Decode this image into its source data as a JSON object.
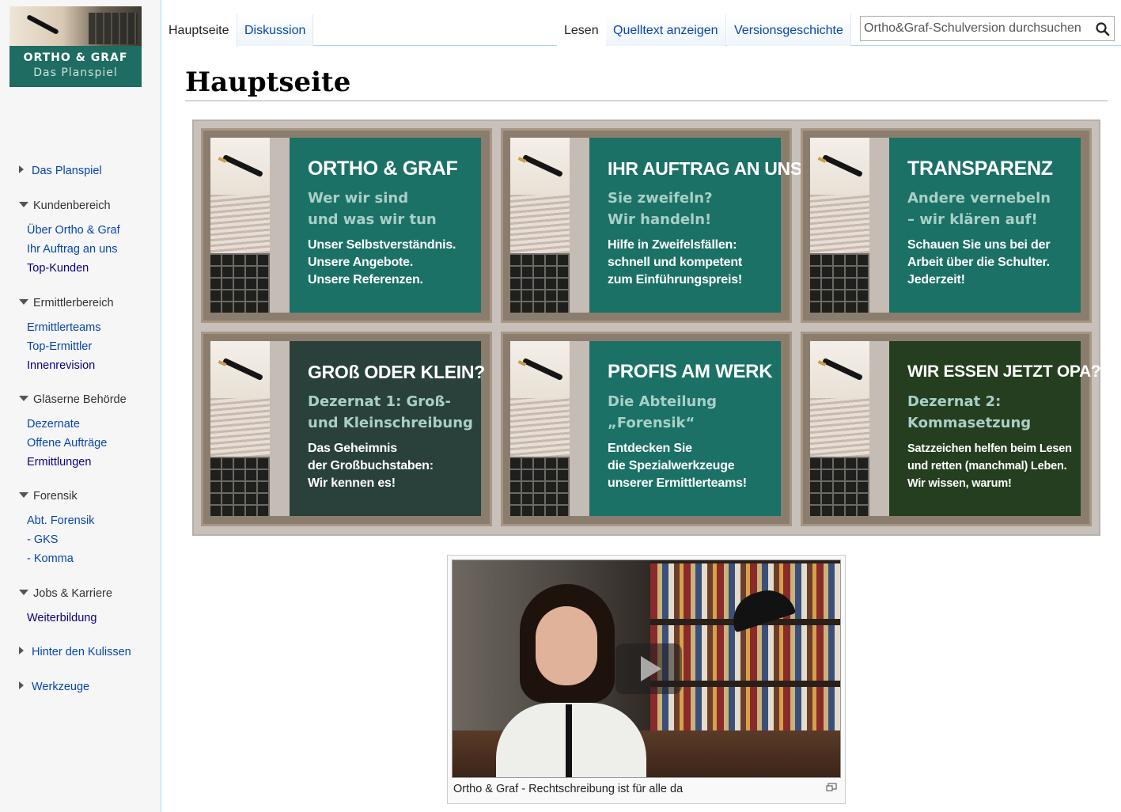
{
  "logo": {
    "title": "ORTHO & GRAF",
    "subtitle": "Das Planspiel"
  },
  "tabs": {
    "left": [
      "Hauptseite",
      "Diskussion"
    ],
    "right": [
      "Lesen",
      "Quelltext anzeigen",
      "Versionsgeschichte"
    ]
  },
  "search": {
    "placeholder": "Ortho&Graf-Schulversion durchsuchen",
    "icon": "search-icon"
  },
  "sidebar": {
    "das_planspiel": "Das Planspiel",
    "kundenbereich": {
      "label": "Kundenbereich",
      "items": [
        "Über Ortho & Graf",
        "Ihr Auftrag an uns",
        "Top-Kunden"
      ]
    },
    "ermittlerbereich": {
      "label": "Ermittlerbereich",
      "items": [
        "Ermittlerteams",
        "Top-Ermittler",
        "Innenrevision"
      ]
    },
    "glaeserne_behoerde": {
      "label": "Gläserne Behörde",
      "items": [
        "Dezernate",
        "Offene Aufträge",
        "Ermittlungen"
      ]
    },
    "forensik": {
      "label": "Forensik",
      "items": [
        "Abt. Forensik",
        "- GKS",
        "- Komma"
      ]
    },
    "jobs": {
      "label": "Jobs & Karriere",
      "items": [
        "Weiterbildung"
      ]
    },
    "hinter_den_kulissen": "Hinter den Kulissen",
    "werkzeuge": "Werkzeuge"
  },
  "page": {
    "title": "Hauptseite"
  },
  "tiles": [
    {
      "heading": "ORTHO & GRAF",
      "sub1": "Wer wir sind",
      "sub2": "und was wir tun",
      "body1": "Unser Selbstverständnis.",
      "body2": "Unsere Angebote.",
      "body3": "Unsere Referenzen.",
      "color": "#1b7166"
    },
    {
      "heading": "IHR AUFTRAG AN UNS",
      "sub1": "Sie zweifeln?",
      "sub2": "Wir handeln!",
      "body1": "Hilfe in Zweifelsfällen:",
      "body2": "schnell und kompetent",
      "body3": "zum Einführungspreis!",
      "color": "#1b7166"
    },
    {
      "heading": "TRANSPARENZ",
      "sub1": "Andere vernebeln",
      "sub2": "– wir klären auf!",
      "body1": "Schauen Sie uns bei der",
      "body2": "Arbeit über die Schulter.",
      "body3": "Jederzeit!",
      "color": "#1b7166"
    },
    {
      "heading": "GROß ODER KLEIN?",
      "sub1": "Dezernat 1: Groß-",
      "sub2": "und Kleinschreibung",
      "body1": "Das Geheimnis",
      "body2": "der Großbuchstaben:",
      "body3": "Wir kennen es!",
      "color": "#29413a"
    },
    {
      "heading": "PROFIS AM WERK",
      "sub1": "Die Abteilung",
      "sub2": "„Forensik“",
      "body1": "Entdecken Sie",
      "body2": "die Spezialwerkzeuge",
      "body3": "unserer Ermittlerteams!",
      "color": "#1b7166"
    },
    {
      "heading": "WIR ESSEN JETZT OPA?!",
      "sub1": "Dezernat 2:",
      "sub2": "Kommasetzung",
      "body1": "Satzzeichen helfen beim Lesen",
      "body2": "und retten (manchmal) Leben.",
      "body3": "Wir wissen, warum!",
      "color": "#243e1f"
    }
  ],
  "video": {
    "caption": "Ortho & Graf - Rechtschreibung ist für alle da",
    "play_icon": "play-icon",
    "enlarge_icon": "enlarge-icon"
  }
}
